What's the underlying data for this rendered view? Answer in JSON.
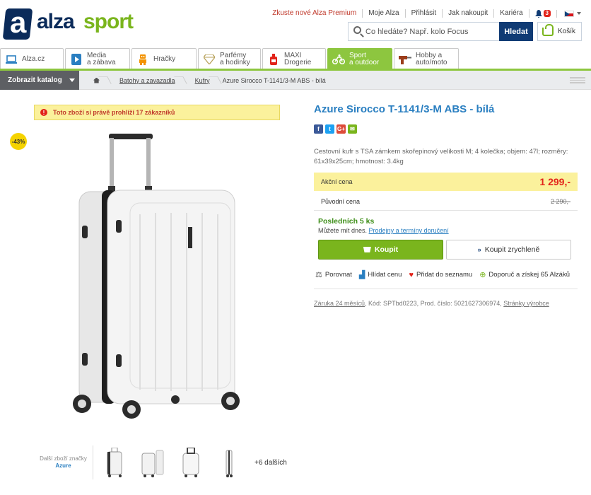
{
  "brand": {
    "logo_letter": "a",
    "logo_word1": "alza",
    "logo_word2": "sport",
    "accent": "#8dc63f",
    "navy": "#103b74"
  },
  "topnav": {
    "premium": "Zkuste nové Alza Premium",
    "moje_alza": "Moje Alza",
    "prihlasit": "Přihlásit",
    "jak_nakoupit": "Jak nakoupit",
    "kariera": "Kariéra",
    "notifications": "3"
  },
  "search": {
    "placeholder": "Co hledáte? Např. kolo Focus",
    "button": "Hledat"
  },
  "cart": {
    "label": "Košík"
  },
  "categories": [
    {
      "label1": "Alza.cz",
      "label2": "",
      "icon": "laptop-icon"
    },
    {
      "label1": "Media",
      "label2": "a zábava",
      "icon": "media-icon"
    },
    {
      "label1": "Hračky",
      "label2": "",
      "icon": "toy-robot-icon"
    },
    {
      "label1": "Parfémy",
      "label2": "a hodinky",
      "icon": "diamond-icon"
    },
    {
      "label1": "MAXI",
      "label2": "Drogerie",
      "icon": "bottle-icon"
    },
    {
      "label1": "Sport",
      "label2": "a outdoor",
      "icon": "bike-icon"
    },
    {
      "label1": "Hobby a",
      "label2": "auto/moto",
      "icon": "drill-icon"
    }
  ],
  "breadcrumb": {
    "catalog_button": "Zobrazit katalog",
    "items": [
      "Batohy a zavazadla",
      "Kufry"
    ],
    "current": "Azure Sirocco T-1141/3-M ABS - bílá"
  },
  "viewers_notice": "Toto zboží si právě prohlíží 17 zákazníků",
  "discount_badge": "-43%",
  "thumbs": {
    "brand_caption": "Další zboží značky",
    "brand_name": "Azure",
    "more": "+6 dalších"
  },
  "product": {
    "title": "Azure Sirocco T-1141/3-M ABS - bílá",
    "description": "Cestovní kufr s TSA zámkem skořepinový velikosti M; 4 kolečka; objem: 47l; rozměry: 61x39x25cm; hmotnost: 3.4kg",
    "sale_label": "Akční cena",
    "sale_price": "1 299,-",
    "orig_label": "Původní cena",
    "orig_price": "2 290,-",
    "stock": "Posledních 5 ks",
    "delivery_prefix": "Můžete mít dnes.",
    "delivery_link": "Prodejny a termíny doručení",
    "buy": "Koupit",
    "quick_buy": "Koupit zrychleně",
    "actions": {
      "compare": "Porovnat",
      "watch": "Hlídat cenu",
      "wishlist": "Přidat do seznamu",
      "recommend": "Doporuč a získej 65 Alzáků"
    },
    "meta": {
      "warranty": "Záruka 24 měsíců",
      "code": "Kód: SPTbd0223,",
      "prod_no": "Prod. číslo: 5021627306974,",
      "producer_pages": "Stránky výrobce"
    }
  },
  "social": [
    "f",
    "t",
    "G+",
    "✉"
  ]
}
